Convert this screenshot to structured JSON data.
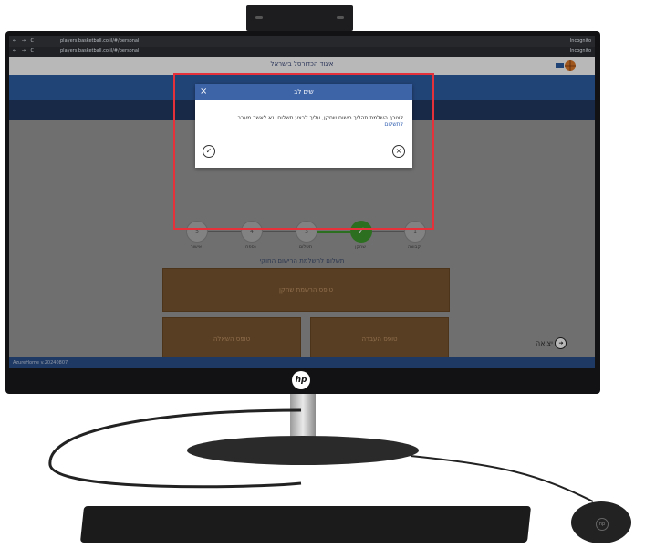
{
  "browser": {
    "tab1_url": "players.basketball.co.il/#/personal",
    "tab2_url": "players.basketball.co.il/#/personal",
    "incognito_label": "Incognito"
  },
  "header": {
    "title": "איגוד הכדורסל בישראל"
  },
  "modal": {
    "title": "שים לב",
    "message": "לצורך השלמת תהליך רישום שחקן, עליך לבצע תשלום. נא לאשר מעבר",
    "link": "לתשלום",
    "ok_symbol": "✓",
    "cancel_symbol": "×",
    "close_symbol": "×"
  },
  "stepper": {
    "steps": [
      {
        "number": "1",
        "label": "קבוצה",
        "done": false
      },
      {
        "number": "✓",
        "label": "שחקן",
        "done": true
      },
      {
        "number": "3",
        "label": "תשלום",
        "done": false
      },
      {
        "number": "4",
        "label": "נספח",
        "done": false
      },
      {
        "number": "5",
        "label": "אישור",
        "done": false
      }
    ],
    "subtitle": "תשלום להשלמת הרישום החוקי"
  },
  "actions": {
    "register_player": "טופס הרשמת שחקן",
    "transfer": "טופס העברה",
    "loan": "טופס השאלה"
  },
  "exit_label": "יציאה",
  "footer_text": "AzureHome v.20240807",
  "colors": {
    "brand_blue": "#2f5fa6",
    "dark_blue": "#223a63",
    "action_brown": "#7b5630",
    "success_green": "#3f9a2f",
    "highlight_red": "#e5323a"
  }
}
